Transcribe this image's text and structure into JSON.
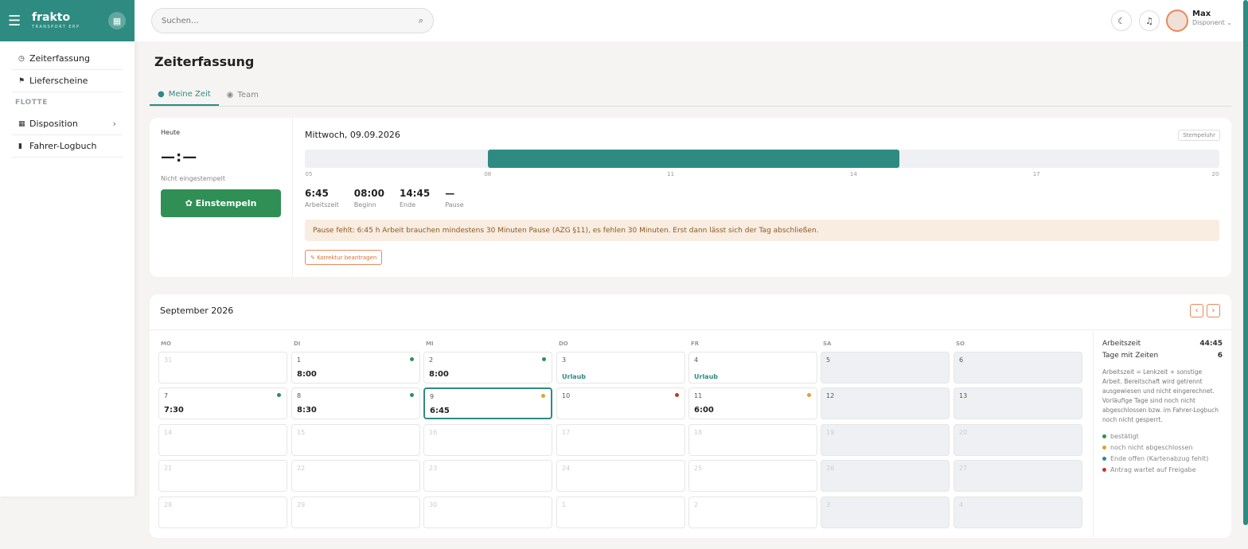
{
  "brand": {
    "name": "frakto",
    "tagline": "TRANSPORT ERP",
    "menu_icon": "menu-icon",
    "apps_icon": "apps-icon"
  },
  "sidebar": {
    "items": [
      {
        "label": "Zeiterfassung",
        "icon": "clock-icon"
      },
      {
        "label": "Lieferscheine",
        "icon": "dolly-icon"
      }
    ],
    "section": "FLOTTE",
    "fleet_items": [
      {
        "label": "Disposition",
        "icon": "calendar-icon"
      },
      {
        "label": "Fahrer-Logbuch",
        "icon": "book-icon"
      }
    ]
  },
  "topbar": {
    "search_placeholder": "Suchen...",
    "user_name": "Max",
    "user_role": "Disponent"
  },
  "page": {
    "title": "Zeiterfassung"
  },
  "tabs": [
    {
      "label": "Meine Zeit",
      "active": true
    },
    {
      "label": "Team",
      "active": false
    }
  ],
  "today": {
    "label": "Heute",
    "clock": "—:—",
    "status": "Nicht eingestempelt",
    "stamp_button": "Einstempeln",
    "date": "Mittwoch, 09.09.2026",
    "stempel_label": "Stempeluhr",
    "timeline": {
      "ticks": [
        "05",
        "08",
        "11",
        "14",
        "17",
        "20"
      ],
      "range_start_hour": 5,
      "range_end_hour": 20,
      "bar_start_hour": 8,
      "bar_end_hour": 14.75
    },
    "stats": [
      {
        "value": "6:45",
        "label": "Arbeitszeit"
      },
      {
        "value": "08:00",
        "label": "Beginn"
      },
      {
        "value": "14:45",
        "label": "Ende"
      },
      {
        "value": "—",
        "label": "Pause"
      }
    ],
    "warning": "Pause fehlt: 6:45 h Arbeit brauchen mindestens 30 Minuten Pause (AZG §11), es fehlen 30 Minuten. Erst dann lässt sich der Tag abschließen.",
    "correction_button": "Korrektur beantragen"
  },
  "calendar": {
    "title": "September 2026",
    "weekdays": [
      "MO",
      "DI",
      "MI",
      "DO",
      "FR",
      "SA",
      "SO"
    ],
    "weeks": [
      [
        {
          "d": "31",
          "other": true
        },
        {
          "d": "1",
          "v": "8:00",
          "dot": "green"
        },
        {
          "d": "2",
          "v": "8:00",
          "dot": "green"
        },
        {
          "d": "3",
          "v": "Urlaub",
          "urlaub": true
        },
        {
          "d": "4",
          "v": "Urlaub",
          "urlaub": true
        },
        {
          "d": "5",
          "weekend": true
        },
        {
          "d": "6",
          "weekend": true
        }
      ],
      [
        {
          "d": "7",
          "v": "7:30",
          "dot": "green"
        },
        {
          "d": "8",
          "v": "8:30",
          "dot": "green"
        },
        {
          "d": "9",
          "v": "6:45",
          "dot": "orange",
          "selected": true
        },
        {
          "d": "10",
          "dot": "red"
        },
        {
          "d": "11",
          "v": "6:00",
          "dot": "orange"
        },
        {
          "d": "12",
          "weekend": true
        },
        {
          "d": "13",
          "weekend": true
        }
      ],
      [
        {
          "d": "14",
          "other": true
        },
        {
          "d": "15",
          "other": true
        },
        {
          "d": "16",
          "other": true
        },
        {
          "d": "17",
          "other": true
        },
        {
          "d": "18",
          "other": true
        },
        {
          "d": "19",
          "weekend": true,
          "other": true
        },
        {
          "d": "20",
          "weekend": true,
          "other": true
        }
      ],
      [
        {
          "d": "21",
          "other": true
        },
        {
          "d": "22",
          "other": true
        },
        {
          "d": "23",
          "other": true
        },
        {
          "d": "24",
          "other": true
        },
        {
          "d": "25",
          "other": true
        },
        {
          "d": "26",
          "weekend": true,
          "other": true
        },
        {
          "d": "27",
          "weekend": true,
          "other": true
        }
      ],
      [
        {
          "d": "28",
          "other": true
        },
        {
          "d": "29",
          "other": true
        },
        {
          "d": "30",
          "other": true
        },
        {
          "d": "1",
          "other": true
        },
        {
          "d": "2",
          "other": true
        },
        {
          "d": "3",
          "weekend": true,
          "other": true
        },
        {
          "d": "4",
          "weekend": true,
          "other": true
        }
      ]
    ],
    "summary": {
      "work_label": "Arbeitszeit",
      "work_value": "44:45",
      "days_label": "Tage mit Zeiten",
      "days_value": "6",
      "note": "Arbeitszeit = Lenkzeit + sonstige Arbeit. Bereitschaft wird getrennt ausgewiesen und nicht eingerechnet. Vorläufige Tage sind noch nicht abgeschlossen bzw. im Fahrer-Logbuch noch nicht gesperrt."
    },
    "legend": [
      {
        "label": "bestätigt",
        "color": "#2f8f55"
      },
      {
        "label": "noch nicht abgeschlossen",
        "color": "#e0a030"
      },
      {
        "label": "Ende offen (Kartenabzug fehlt)",
        "color": "#2e8b81"
      },
      {
        "label": "Antrag wartet auf Freigabe",
        "color": "#c0392b"
      }
    ]
  },
  "colors": {
    "accent": "#2e8b81",
    "green": "#2f8f55",
    "orange": "#e0a030",
    "red": "#c0392b",
    "warn_bg": "#f9ece0"
  }
}
